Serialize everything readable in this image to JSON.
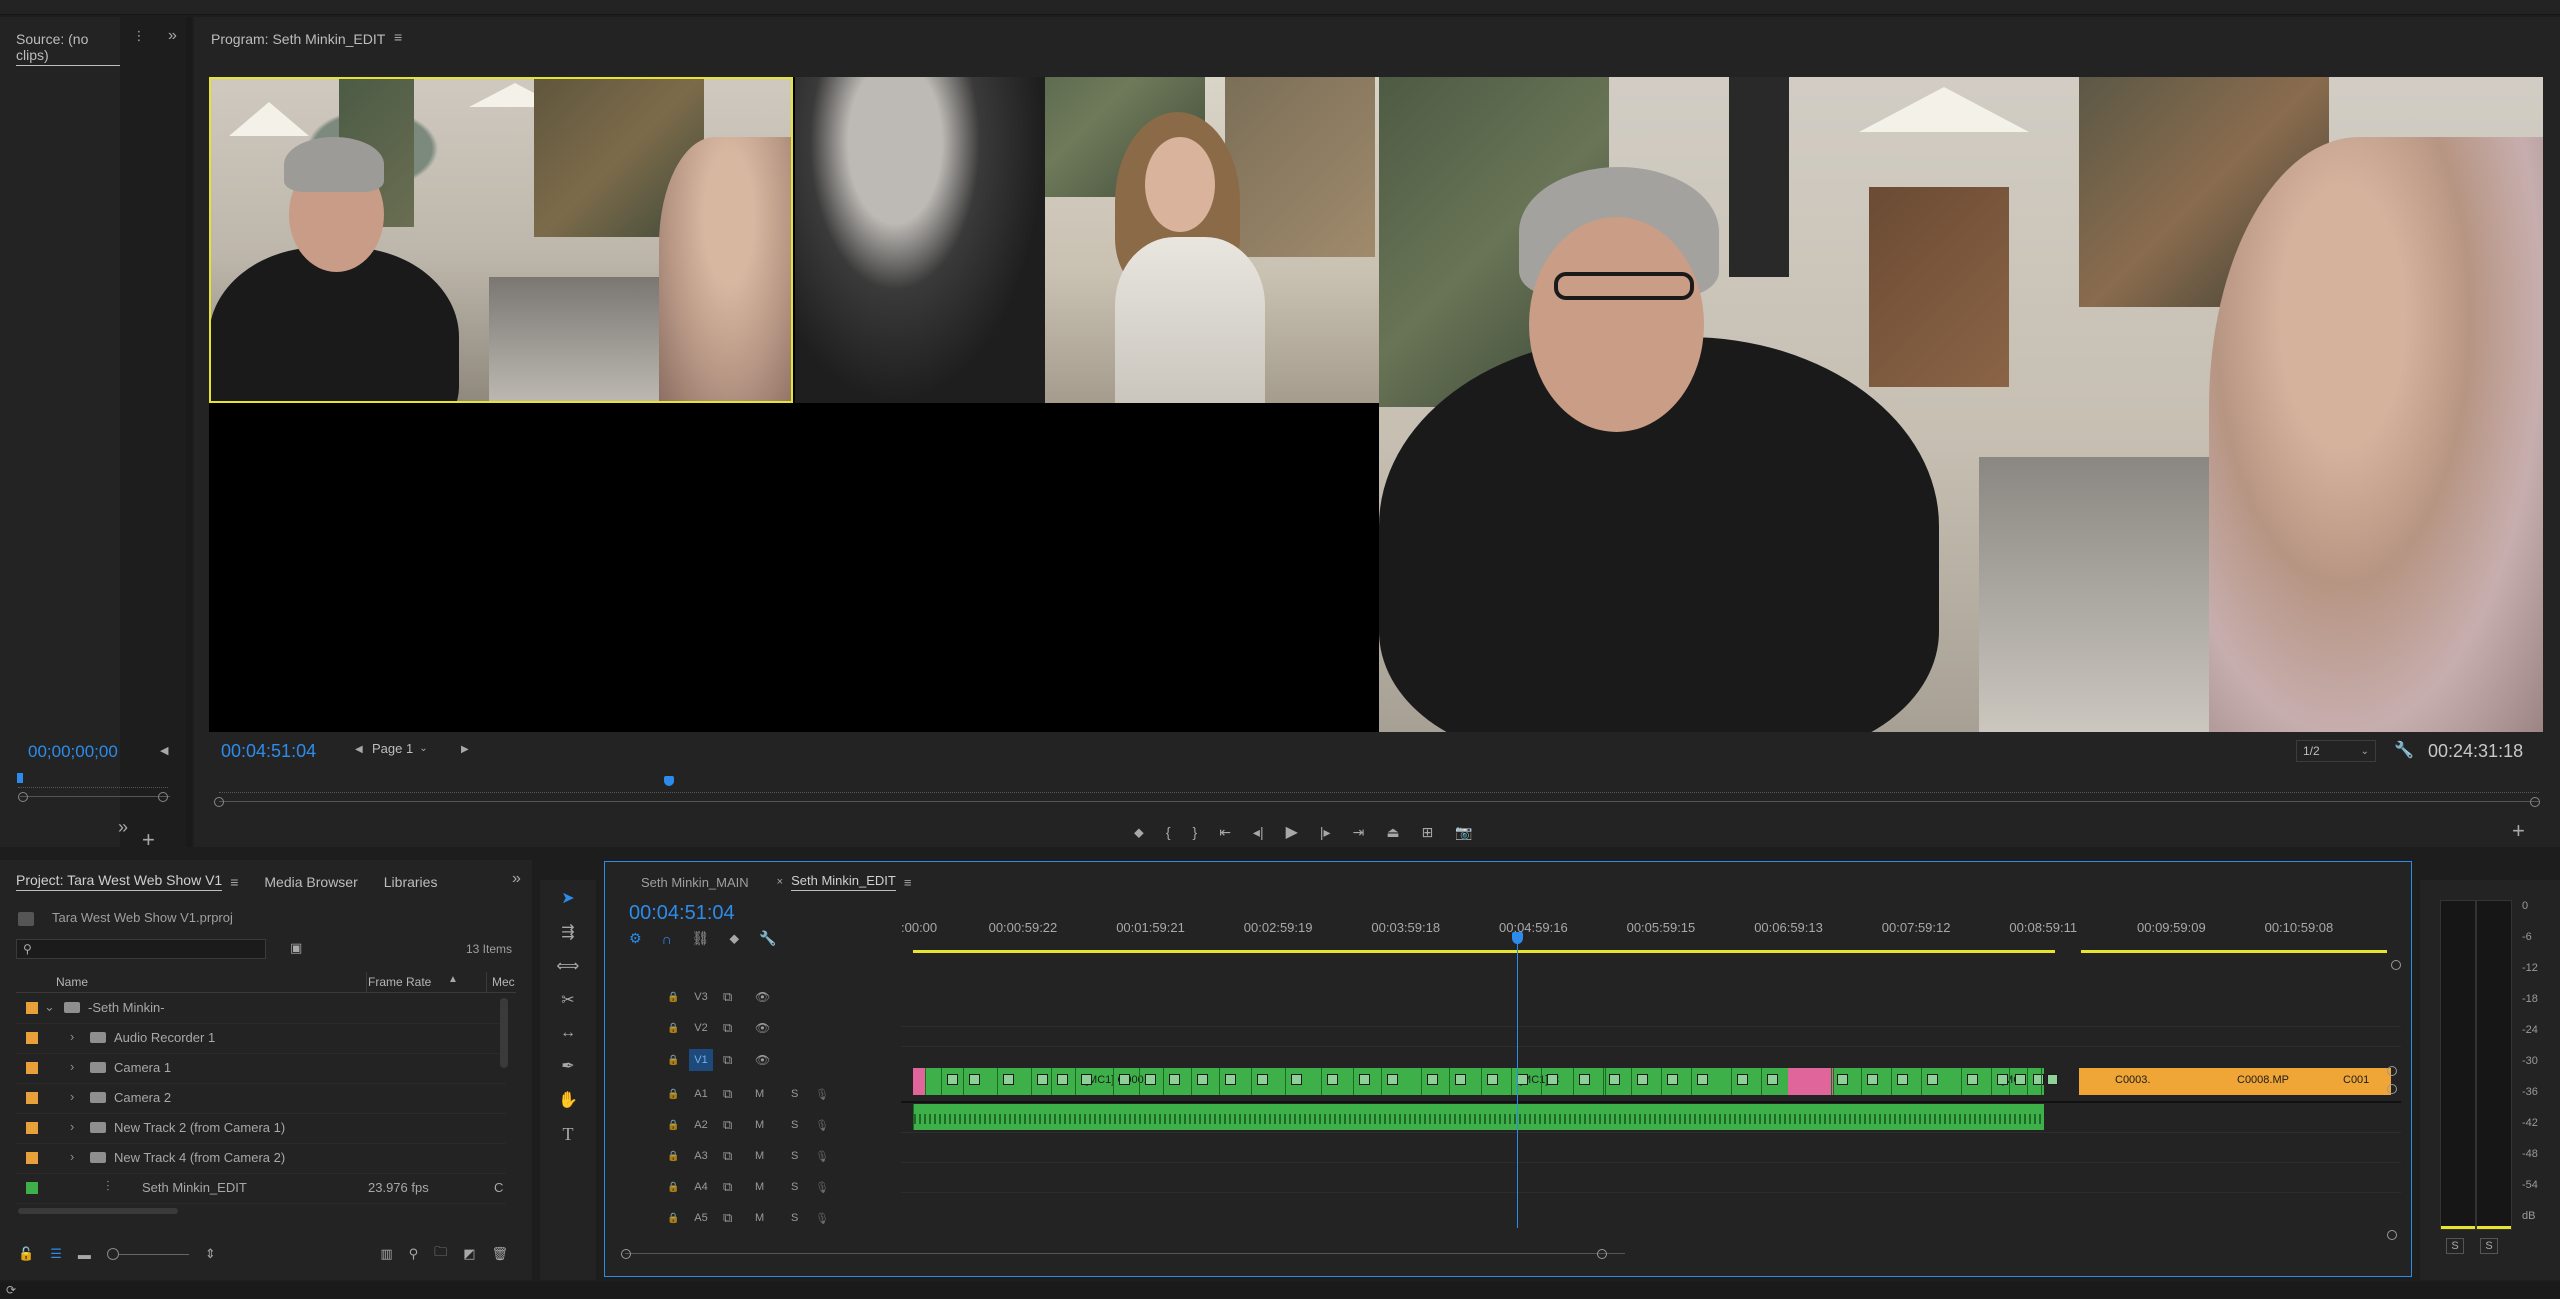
{
  "source_panel": {
    "title": "Source: (no clips)",
    "timecode": "00;00;00;00"
  },
  "program_panel": {
    "title": "Program: Seth Minkin_EDIT",
    "timecode": "00:04:51:04",
    "page_select": "Page 1",
    "resolution": "1/2",
    "duration": "00:24:31:18"
  },
  "project_panel": {
    "tabs": [
      "Project: Tara West Web Show V1",
      "Media Browser",
      "Libraries"
    ],
    "file_name": "Tara West Web Show V1.prproj",
    "item_count": "13 Items",
    "search_placeholder": "",
    "columns": [
      "Name",
      "Frame Rate",
      "Mec"
    ],
    "items": [
      {
        "name": "-Seth Minkin-",
        "frame_rate": "",
        "label_color": "#e8a13a",
        "kind": "folder",
        "expanded": true
      },
      {
        "name": "Audio Recorder 1",
        "frame_rate": "",
        "label_color": "#e8a13a",
        "kind": "folder"
      },
      {
        "name": "Camera 1",
        "frame_rate": "",
        "label_color": "#e8a13a",
        "kind": "folder"
      },
      {
        "name": "Camera 2",
        "frame_rate": "",
        "label_color": "#e8a13a",
        "kind": "folder"
      },
      {
        "name": "New Track 2 (from Camera 1)",
        "frame_rate": "",
        "label_color": "#e8a13a",
        "kind": "folder"
      },
      {
        "name": "New Track 4 (from Camera 2)",
        "frame_rate": "",
        "label_color": "#e8a13a",
        "kind": "folder"
      },
      {
        "name": "Seth Minkin_EDIT",
        "frame_rate": "23.976 fps",
        "label_color": "#3db049",
        "kind": "sequence",
        "extra": "C"
      }
    ]
  },
  "timeline": {
    "tabs": [
      "Seth Minkin_MAIN",
      "Seth Minkin_EDIT"
    ],
    "timecode": "00:04:51:04",
    "ruler": [
      ":00:00",
      "00:00:59:22",
      "00:01:59:21",
      "00:02:59:19",
      "00:03:59:18",
      "00:04:59:16",
      "00:05:59:15",
      "00:06:59:13",
      "00:07:59:12",
      "00:08:59:11",
      "00:09:59:09",
      "00:10:59:08"
    ],
    "video_tracks": [
      {
        "label": "V3"
      },
      {
        "label": "V2"
      },
      {
        "label": "V1",
        "active": true
      }
    ],
    "audio_tracks": [
      {
        "label": "A1",
        "m": "M",
        "s": "S"
      },
      {
        "label": "A2",
        "m": "M",
        "s": "S"
      },
      {
        "label": "A3",
        "m": "M",
        "s": "S"
      },
      {
        "label": "A4",
        "m": "M",
        "s": "S"
      },
      {
        "label": "A5",
        "m": "M",
        "s": "S"
      }
    ],
    "clip_labels": [
      "[MC1] C0001",
      "[MC1] C",
      "[MC",
      "C0003.",
      "C0008.MP",
      "C001"
    ]
  },
  "audio_meter": {
    "scale": [
      "0",
      "-6",
      "-12",
      "-18",
      "-24",
      "-30",
      "-36",
      "-42",
      "-48",
      "-54",
      "dB"
    ],
    "solo": [
      "S",
      "S"
    ]
  },
  "colors": {
    "timecode_blue": "#2d8ceb",
    "clip_green": "#3db049",
    "clip_pink": "#e0659a",
    "clip_orange": "#f0a637",
    "selection_yellow": "#e6e431"
  }
}
